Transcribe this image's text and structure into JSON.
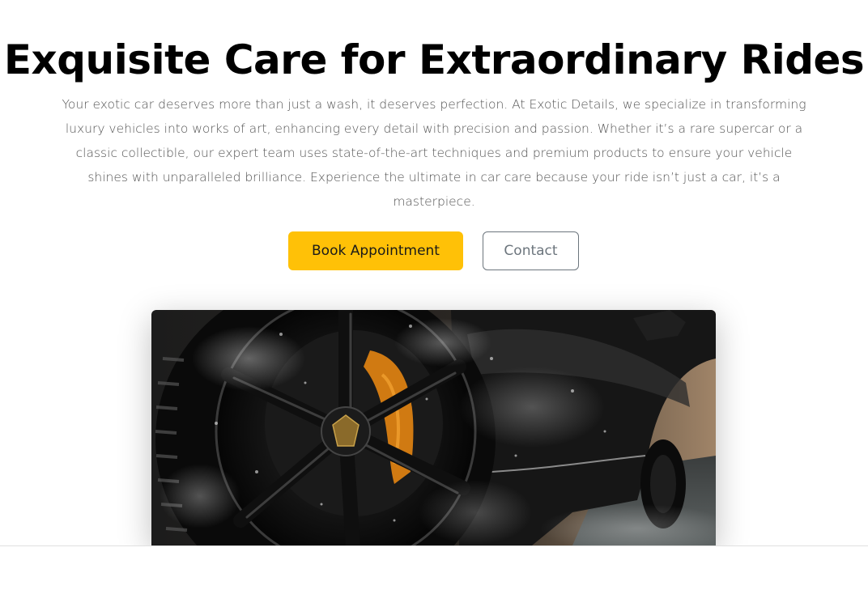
{
  "hero": {
    "title": "Exquisite Care for Extraordinary Rides",
    "description": "Your exotic car deserves more than just a wash, it deserves perfection. At Exotic Details, we specialize in transforming luxury vehicles into works of art, enhancing every detail with precision and passion. Whether it’s a rare supercar or a classic collectible, our expert team uses state-of-the-art techniques and premium products to ensure your vehicle shines with unparalleled brilliance. Experience the ultimate in car care because your ride isn’t just a car, it’s a masterpiece."
  },
  "buttons": {
    "primary_label": "Book Appointment",
    "secondary_label": "Contact"
  },
  "image": {
    "alt": "Black exotic car wheel covered in foam during wash"
  },
  "colors": {
    "accent": "#ffc107",
    "secondary_border": "#6c757d",
    "title": "#000000",
    "body_text": "#555555"
  }
}
